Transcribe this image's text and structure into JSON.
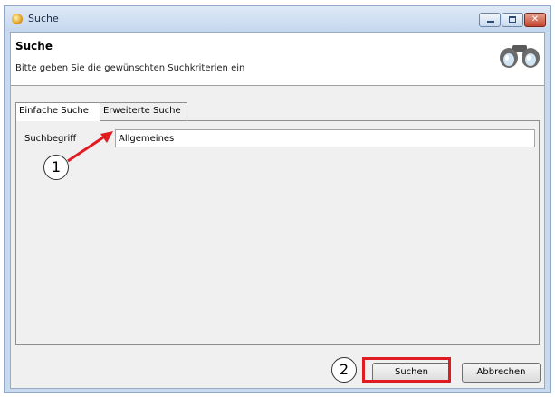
{
  "window": {
    "title": "Suche",
    "icon": "search-app-icon",
    "controls": [
      "minimize-icon",
      "maximize-icon",
      "close-icon"
    ]
  },
  "header": {
    "title": "Suche",
    "subtitle": "Bitte geben Sie die gewünschten Suchkriterien ein",
    "icon": "binoculars-icon"
  },
  "tabs": [
    {
      "label": "Einfache Suche",
      "active": true
    },
    {
      "label": "Erweiterte Suche",
      "active": false
    }
  ],
  "form": {
    "search_label": "Suchbegriff",
    "search_value": "Allgemeines"
  },
  "buttons": {
    "search": "Suchen",
    "cancel": "Abbrechen"
  },
  "annotations": {
    "callout1": "1",
    "callout2": "2",
    "accent": "#e11b22"
  }
}
